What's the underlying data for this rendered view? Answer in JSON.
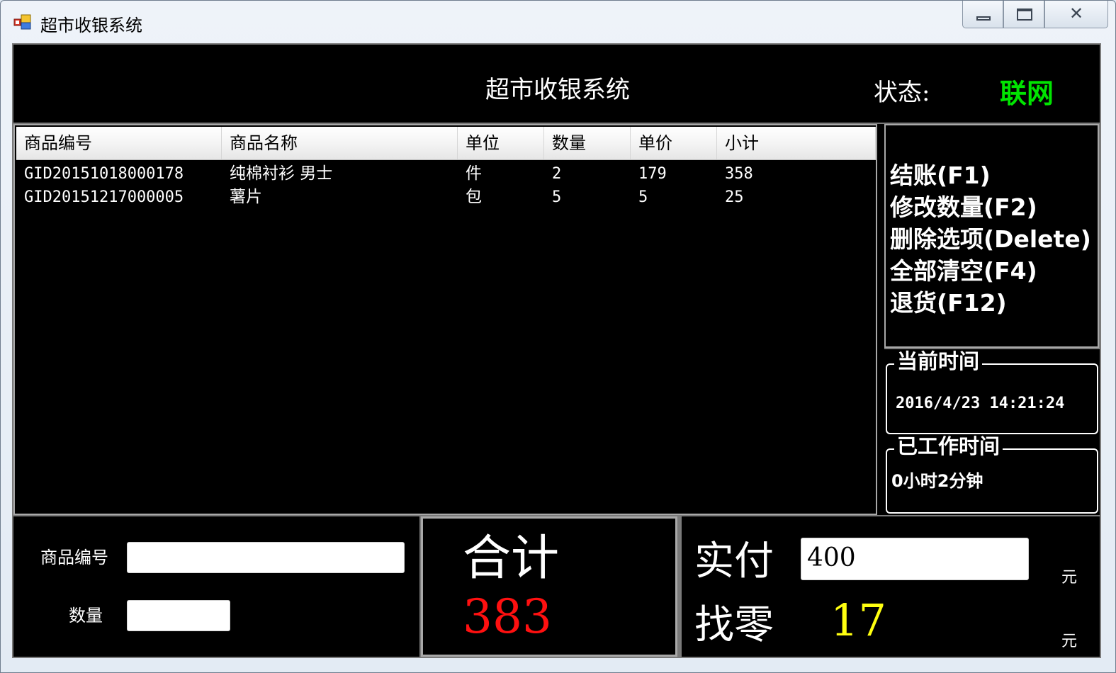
{
  "window": {
    "title": "超市收银系统",
    "minimize_icon": "minimize-icon",
    "maximize_icon": "restore-icon",
    "close_icon": "close-icon",
    "close_glyph": "✕"
  },
  "header": {
    "title": "超市收银系统",
    "status_label": "状态:",
    "status_value": "联网",
    "status_color": "#00e400"
  },
  "table": {
    "columns": [
      "商品编号",
      "商品名称",
      "单位",
      "数量",
      "单价",
      "小计"
    ],
    "rows": [
      [
        "GID20151018000178",
        "纯棉衬衫 男士",
        "件",
        "2",
        "179",
        "358"
      ],
      [
        "GID20151217000005",
        "薯片",
        "包",
        "5",
        "5",
        "25"
      ]
    ]
  },
  "shortcuts": [
    "结账(F1)",
    "修改数量(F2)",
    "删除选项(Delete)",
    "全部清空(F4)",
    "退货(F12)"
  ],
  "current_time": {
    "legend": "当前时间",
    "value": "2016/4/23 14:21:24"
  },
  "work_time": {
    "legend": "已工作时间",
    "value": "0小时2分钟"
  },
  "entry": {
    "product_code_label": "商品编号",
    "product_code_value": "",
    "quantity_label": "数量",
    "quantity_value": ""
  },
  "totals": {
    "total_label": "合计",
    "total_value": "383",
    "total_color": "#ff1010",
    "paid_label": "实付",
    "paid_value": "400",
    "change_label": "找零",
    "change_value": "17",
    "change_color": "#ffff10",
    "unit": "元"
  }
}
